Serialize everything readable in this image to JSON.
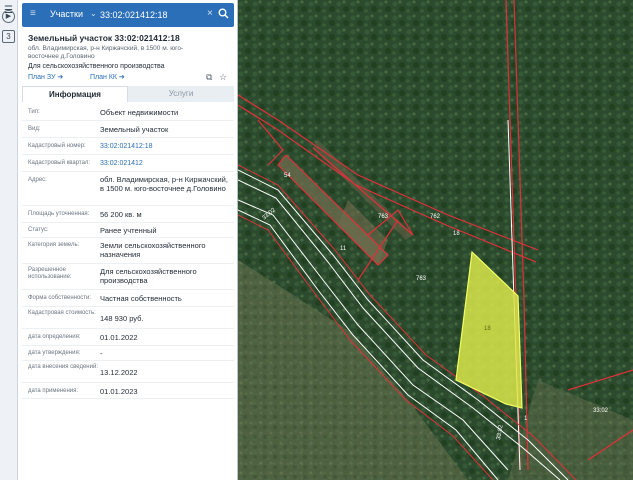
{
  "rail": {
    "icons": [
      "menu-icon",
      "play-icon",
      "number-3-icon"
    ],
    "badge": "3"
  },
  "search": {
    "menu_icon": "≡",
    "type_label": "Участки",
    "value": "33:02:021412:18",
    "clear_icon": "×",
    "search_icon": "⚲"
  },
  "header": {
    "title": "Земельный участок 33:02:021412:18",
    "address": "обл. Владимирская, р-н Киржачский, в 1500 м. юго-восточнее д.Головино",
    "usage": "Для сельскохозяйственного производства",
    "plan_zu": "План ЗУ ➔",
    "plan_kk": "План КК ➔"
  },
  "tabs": {
    "info": "Информация",
    "services": "Услуги"
  },
  "rows": [
    {
      "k": "Тип:",
      "v": "Объект недвижимости"
    },
    {
      "k": "Вид:",
      "v": "Земельный участок"
    },
    {
      "k": "Кадастровый номер:",
      "v": "33:02:021412:18",
      "link": true
    },
    {
      "k": "Кадастровый квартал:",
      "v": "33:02:021412",
      "link": true
    },
    {
      "k": "Адрес:",
      "v": "обл. Владимирская, р-н Киржачский, в 1500 м. юго-восточнее д.Головино"
    },
    {
      "k": "Площадь уточненная:",
      "v": "56 200 кв. м"
    },
    {
      "k": "Статус:",
      "v": "Ранее учтенный"
    },
    {
      "k": "Категория земель:",
      "v": "Земли сельскохозяйственного назначения"
    },
    {
      "k": "Разрешенное использование:",
      "v": "Для сельскохозяйственного производства"
    },
    {
      "k": "Форма собственности:",
      "v": "Частная собственность"
    },
    {
      "k": "Кадастровая стоимость:",
      "v": "148 930 руб."
    },
    {
      "k": "дата определения:",
      "v": "01.01.2022"
    },
    {
      "k": "дата утверждения:",
      "v": "-"
    },
    {
      "k": "дата внесения сведений:",
      "v": "13.12.2022"
    },
    {
      "k": "дата применения:",
      "v": "01.01.2023"
    }
  ],
  "map": {
    "labels": [
      "54",
      "763",
      "762",
      "11",
      "18",
      "763",
      "33:02",
      "33:02",
      "18",
      "1",
      "33:02"
    ],
    "colors": {
      "parcel_fill": "#d9e84a",
      "boundary": "#e0303a",
      "road": "#ffffff"
    }
  }
}
